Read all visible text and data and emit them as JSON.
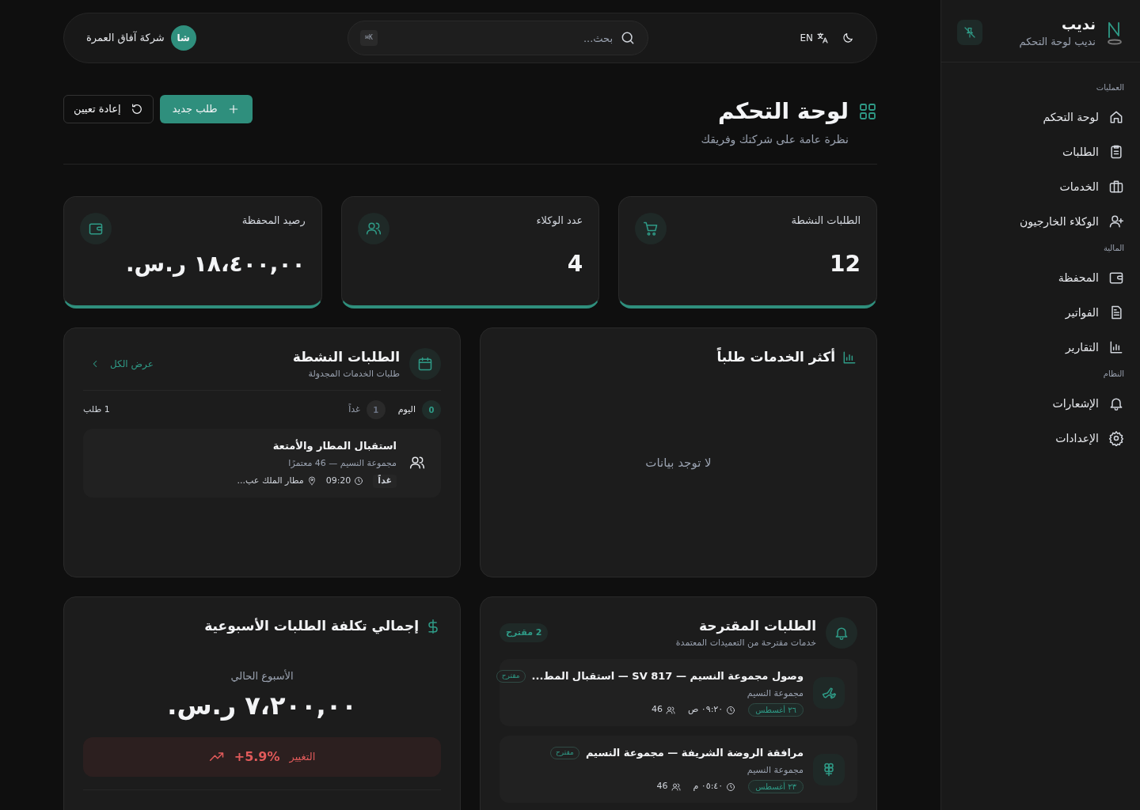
{
  "sidebar": {
    "brand": "نديب",
    "subtitle": "نديب لوحة التحكم",
    "sections": [
      {
        "title": "العمليات",
        "items": [
          {
            "label": "لوحة التحكم"
          },
          {
            "label": "الطلبات"
          },
          {
            "label": "الخدمات"
          },
          {
            "label": "الوكلاء الخارجيون"
          }
        ]
      },
      {
        "title": "المالية",
        "items": [
          {
            "label": "المحفظة"
          },
          {
            "label": "الفواتير"
          },
          {
            "label": "التقارير"
          }
        ]
      },
      {
        "title": "النظام",
        "items": [
          {
            "label": "الإشعارات"
          },
          {
            "label": "الإعدادات"
          }
        ]
      }
    ]
  },
  "topbar": {
    "company": "شركة آفاق العمرة",
    "avatar": "شا",
    "search_placeholder": "بحث...",
    "shortcut": "K⌘",
    "language": "EN"
  },
  "header": {
    "title": "لوحة التحكم",
    "subtitle": "نظرة عامة على شركتك وفريقك",
    "primary_button": "طلب جديد",
    "secondary_button": "إعادة تعيين"
  },
  "stats": [
    {
      "label": "الطلبات النشطة",
      "value": "12"
    },
    {
      "label": "عدد الوكلاء",
      "value": "4"
    },
    {
      "label": "رصيد المحفظة",
      "value": "١٨،٤٠٠,٠٠ ر.س."
    }
  ],
  "top_services": {
    "title": "أكثر الخدمات طلباً",
    "empty": "لا توجد بيانات"
  },
  "active_requests": {
    "title": "الطلبات النشطة",
    "subtitle": "طلبات الخدمات المجدولة",
    "view_all": "عرض الكل",
    "days": [
      {
        "count": "0",
        "label": "اليوم",
        "selected": true
      },
      {
        "count": "1",
        "label": "غداً",
        "selected": false
      }
    ],
    "total": "1 طلب",
    "items": [
      {
        "title": "استقبال المطار والأمتعة",
        "group": "مجموعة النسيم — 46 معتمرًا",
        "day": "غداً",
        "time": "09:20",
        "place": "مطار الملك عب..."
      }
    ]
  },
  "suggested": {
    "title": "الطلبات المقترحة",
    "subtitle": "خدمات مقترحة من التعميدات المعتمدة",
    "count": "2 مقترح",
    "items": [
      {
        "kind": "flight",
        "title": "وصول مجموعة النسيم — SV 817 — استقبال المط...",
        "tag": "مقترح",
        "group": "مجموعة النسيم",
        "date": "٢٦ أغسطس",
        "time": "٠٩:٢٠ ص",
        "people": "46"
      },
      {
        "kind": "visit",
        "title": "مرافقة الروضة الشريفة — مجموعة النسيم",
        "tag": "مقترح",
        "group": "مجموعة النسيم",
        "date": "٢٣ أغسطس",
        "time": "٠٥:٤٠ م",
        "people": "46"
      }
    ]
  },
  "weekly_cost": {
    "title": "إجمالي تكلفة الطلبات الأسبوعية",
    "period": "الأسبوع الحالي",
    "amount": "٧،٢٠٠,٠٠ ر.س.",
    "change": "+5.9%",
    "change_label": "التغيير"
  }
}
